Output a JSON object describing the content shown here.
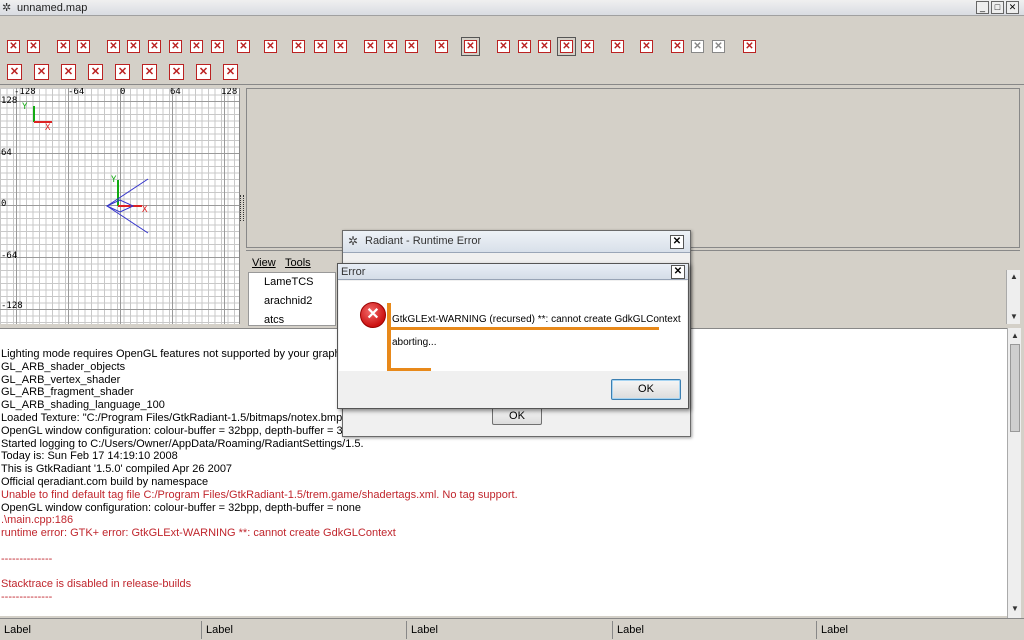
{
  "window": {
    "title": "unnamed.map",
    "logo_icon": "gear-icon",
    "minimize": "_",
    "maximize": "□",
    "close": "✕"
  },
  "toolbar": {
    "glyph": "✕"
  },
  "grid": {
    "labels_top": [
      "-128",
      "-64",
      "0",
      "64",
      "128"
    ],
    "labels_left": [
      "128",
      "64",
      "0",
      "-64",
      "-128"
    ],
    "axis_y": "Y",
    "axis_x": "X"
  },
  "texture_pane": {
    "menu_view": "View",
    "menu_tools": "Tools",
    "items": [
      "LameTCS",
      "arachnid2",
      "atcs"
    ]
  },
  "console": {
    "lines": [
      {
        "text": "Lighting mode requires OpenGL features not supported by your graphics",
        "error": false
      },
      {
        "text": "  GL_ARB_shader_objects",
        "error": false
      },
      {
        "text": "  GL_ARB_vertex_shader",
        "error": false
      },
      {
        "text": "  GL_ARB_fragment_shader",
        "error": false
      },
      {
        "text": "  GL_ARB_shading_language_100",
        "error": false
      },
      {
        "text": "Loaded Texture: \"C:/Program Files/GtkRadiant-1.5/bitmaps/notex.bmp\"",
        "error": false
      },
      {
        "text": "OpenGL window configuration: colour-buffer = 32bpp, depth-buffer = 32bpp",
        "error": false
      },
      {
        "text": "Started logging to C:/Users/Owner/AppData/Roaming/RadiantSettings/1.5.",
        "error": false
      },
      {
        "text": "Today is: Sun Feb 17 14:19:10 2008",
        "error": false
      },
      {
        "text": "This is GtkRadiant '1.5.0' compiled Apr 26 2007",
        "error": false
      },
      {
        "text": "Official qeradiant.com build by namespace",
        "error": false
      },
      {
        "text": "Unable to find default tag file C:/Program Files/GtkRadiant-1.5/trem.game/shadertags.xml. No tag support.",
        "error": true
      },
      {
        "text": "OpenGL window configuration: colour-buffer = 32bpp, depth-buffer = none",
        "error": false
      },
      {
        "text": ".\\main.cpp:186",
        "error": true
      },
      {
        "text": "runtime error: GTK+ error: GtkGLExt-WARNING **: cannot create GdkGLContext",
        "error": true
      },
      {
        "text": "",
        "error": false
      },
      {
        "text": "--------------",
        "error": true
      },
      {
        "text": "",
        "error": false
      },
      {
        "text": "Stacktrace is disabled in release-builds",
        "error": true
      },
      {
        "text": "--------------",
        "error": true
      }
    ]
  },
  "status_bar": [
    "Label",
    "Label",
    "Label",
    "Label",
    "Label"
  ],
  "dialog_runtime": {
    "title": "Radiant - Runtime Error",
    "close": "✕",
    "ok_label": "OK"
  },
  "dialog_error": {
    "title": "Error",
    "close": "✕",
    "icon": "error-x-icon",
    "message": "GtkGLExt-WARNING (recursed) **: cannot create GdkGLContext",
    "detail": "aborting...",
    "ok_label": "OK",
    "annotation_color": "#e8891a"
  }
}
